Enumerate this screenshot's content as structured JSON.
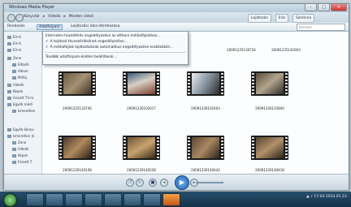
{
  "window": {
    "title": "Windows Media Player",
    "controls": [
      "–",
      "□",
      "✕"
    ]
  },
  "nav": {
    "breadcrumb": [
      "Könyvtár",
      "Videók",
      "Minden videó"
    ],
    "tabs": [
      "Lejátszás",
      "Írás",
      "Szinkron"
    ]
  },
  "toolbar": {
    "organize": "Rendezés",
    "stream": "Adatfolyam",
    "create_playlist": "Lejátszási lista létrehozása",
    "search_placeholder": "Keresés"
  },
  "sidebar": {
    "items": [
      {
        "label": "Ell-rk",
        "icon": "playlist-icon"
      },
      {
        "label": "Ell-rk",
        "icon": "playlist-icon"
      },
      {
        "label": "Ell-rk",
        "icon": "playlist-icon"
      },
      {
        "label": "Zene",
        "icon": "music-icon"
      },
      {
        "label": "Előadó",
        "icon": "artist-icon"
      },
      {
        "label": "Album",
        "icon": "album-icon"
      },
      {
        "label": "Műfaj",
        "icon": "genre-icon"
      },
      {
        "label": "Videók",
        "icon": "video-icon"
      },
      {
        "label": "Képek",
        "icon": "picture-icon"
      },
      {
        "label": "Felvett TV-m.",
        "icon": "tv-icon"
      },
      {
        "label": "Egyéb médi",
        "icon": "media-icon"
      },
      {
        "label": "Ismeretlen",
        "icon": "unknown-icon"
      },
      {
        "label": "Egyéb könyv.",
        "icon": "library-icon"
      },
      {
        "label": "Ismeretlen (k",
        "icon": "library-icon"
      },
      {
        "label": "Zene",
        "icon": "music-icon"
      },
      {
        "label": "Videók",
        "icon": "video-icon"
      },
      {
        "label": "Képek",
        "icon": "picture-icon"
      },
      {
        "label": "Felvett T",
        "icon": "tv-icon"
      }
    ]
  },
  "stream_menu": {
    "items": [
      {
        "label": "Internetes hozzáférés engedélyezése az otthoni médiafájlokhoz...",
        "checked": false
      },
      {
        "label": "A lejátszó távvezérlésének engedélyezése...",
        "checked": true
      },
      {
        "label": "A médiafájlok lejátszásának automatikus engedélyezése eszközökön...",
        "checked": true
      },
      {
        "label": "További adatfolyam-küldési beállítások...",
        "checked": false
      }
    ]
  },
  "videos": [
    {
      "title": "20091225133746"
    },
    {
      "title": "20091226102017"
    },
    {
      "title": "20091226102403"
    },
    {
      "title": "20091226125840"
    },
    {
      "title": "20091226140108"
    },
    {
      "title": "20091226140228"
    },
    {
      "title": "20091226140442"
    },
    {
      "title": "20091226140418"
    }
  ],
  "top_captions": [
    "20091225130734",
    "20091225141903"
  ],
  "player": {
    "controls": [
      "shuffle-icon",
      "repeat-icon",
      "stop-icon",
      "previous-icon",
      "play-icon",
      "next-icon",
      "volume-icon"
    ]
  },
  "taskbar": {
    "clock": "17:04",
    "date": "2010.01.23."
  },
  "colors": {
    "accent": "#1f5fb0",
    "taskbar": "#1e4260"
  }
}
